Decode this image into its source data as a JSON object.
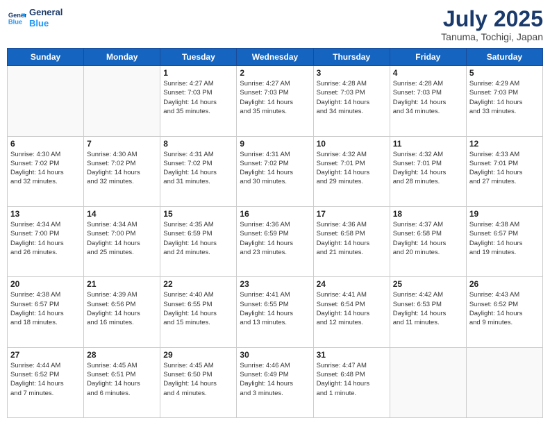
{
  "header": {
    "logo_general": "General",
    "logo_blue": "Blue",
    "month_year": "July 2025",
    "location": "Tanuma, Tochigi, Japan"
  },
  "days_of_week": [
    "Sunday",
    "Monday",
    "Tuesday",
    "Wednesday",
    "Thursday",
    "Friday",
    "Saturday"
  ],
  "weeks": [
    [
      {
        "day": "",
        "content": ""
      },
      {
        "day": "",
        "content": ""
      },
      {
        "day": "1",
        "content": "Sunrise: 4:27 AM\nSunset: 7:03 PM\nDaylight: 14 hours\nand 35 minutes."
      },
      {
        "day": "2",
        "content": "Sunrise: 4:27 AM\nSunset: 7:03 PM\nDaylight: 14 hours\nand 35 minutes."
      },
      {
        "day": "3",
        "content": "Sunrise: 4:28 AM\nSunset: 7:03 PM\nDaylight: 14 hours\nand 34 minutes."
      },
      {
        "day": "4",
        "content": "Sunrise: 4:28 AM\nSunset: 7:03 PM\nDaylight: 14 hours\nand 34 minutes."
      },
      {
        "day": "5",
        "content": "Sunrise: 4:29 AM\nSunset: 7:03 PM\nDaylight: 14 hours\nand 33 minutes."
      }
    ],
    [
      {
        "day": "6",
        "content": "Sunrise: 4:30 AM\nSunset: 7:02 PM\nDaylight: 14 hours\nand 32 minutes."
      },
      {
        "day": "7",
        "content": "Sunrise: 4:30 AM\nSunset: 7:02 PM\nDaylight: 14 hours\nand 32 minutes."
      },
      {
        "day": "8",
        "content": "Sunrise: 4:31 AM\nSunset: 7:02 PM\nDaylight: 14 hours\nand 31 minutes."
      },
      {
        "day": "9",
        "content": "Sunrise: 4:31 AM\nSunset: 7:02 PM\nDaylight: 14 hours\nand 30 minutes."
      },
      {
        "day": "10",
        "content": "Sunrise: 4:32 AM\nSunset: 7:01 PM\nDaylight: 14 hours\nand 29 minutes."
      },
      {
        "day": "11",
        "content": "Sunrise: 4:32 AM\nSunset: 7:01 PM\nDaylight: 14 hours\nand 28 minutes."
      },
      {
        "day": "12",
        "content": "Sunrise: 4:33 AM\nSunset: 7:01 PM\nDaylight: 14 hours\nand 27 minutes."
      }
    ],
    [
      {
        "day": "13",
        "content": "Sunrise: 4:34 AM\nSunset: 7:00 PM\nDaylight: 14 hours\nand 26 minutes."
      },
      {
        "day": "14",
        "content": "Sunrise: 4:34 AM\nSunset: 7:00 PM\nDaylight: 14 hours\nand 25 minutes."
      },
      {
        "day": "15",
        "content": "Sunrise: 4:35 AM\nSunset: 6:59 PM\nDaylight: 14 hours\nand 24 minutes."
      },
      {
        "day": "16",
        "content": "Sunrise: 4:36 AM\nSunset: 6:59 PM\nDaylight: 14 hours\nand 23 minutes."
      },
      {
        "day": "17",
        "content": "Sunrise: 4:36 AM\nSunset: 6:58 PM\nDaylight: 14 hours\nand 21 minutes."
      },
      {
        "day": "18",
        "content": "Sunrise: 4:37 AM\nSunset: 6:58 PM\nDaylight: 14 hours\nand 20 minutes."
      },
      {
        "day": "19",
        "content": "Sunrise: 4:38 AM\nSunset: 6:57 PM\nDaylight: 14 hours\nand 19 minutes."
      }
    ],
    [
      {
        "day": "20",
        "content": "Sunrise: 4:38 AM\nSunset: 6:57 PM\nDaylight: 14 hours\nand 18 minutes."
      },
      {
        "day": "21",
        "content": "Sunrise: 4:39 AM\nSunset: 6:56 PM\nDaylight: 14 hours\nand 16 minutes."
      },
      {
        "day": "22",
        "content": "Sunrise: 4:40 AM\nSunset: 6:55 PM\nDaylight: 14 hours\nand 15 minutes."
      },
      {
        "day": "23",
        "content": "Sunrise: 4:41 AM\nSunset: 6:55 PM\nDaylight: 14 hours\nand 13 minutes."
      },
      {
        "day": "24",
        "content": "Sunrise: 4:41 AM\nSunset: 6:54 PM\nDaylight: 14 hours\nand 12 minutes."
      },
      {
        "day": "25",
        "content": "Sunrise: 4:42 AM\nSunset: 6:53 PM\nDaylight: 14 hours\nand 11 minutes."
      },
      {
        "day": "26",
        "content": "Sunrise: 4:43 AM\nSunset: 6:52 PM\nDaylight: 14 hours\nand 9 minutes."
      }
    ],
    [
      {
        "day": "27",
        "content": "Sunrise: 4:44 AM\nSunset: 6:52 PM\nDaylight: 14 hours\nand 7 minutes."
      },
      {
        "day": "28",
        "content": "Sunrise: 4:45 AM\nSunset: 6:51 PM\nDaylight: 14 hours\nand 6 minutes."
      },
      {
        "day": "29",
        "content": "Sunrise: 4:45 AM\nSunset: 6:50 PM\nDaylight: 14 hours\nand 4 minutes."
      },
      {
        "day": "30",
        "content": "Sunrise: 4:46 AM\nSunset: 6:49 PM\nDaylight: 14 hours\nand 3 minutes."
      },
      {
        "day": "31",
        "content": "Sunrise: 4:47 AM\nSunset: 6:48 PM\nDaylight: 14 hours\nand 1 minute."
      },
      {
        "day": "",
        "content": ""
      },
      {
        "day": "",
        "content": ""
      }
    ]
  ]
}
